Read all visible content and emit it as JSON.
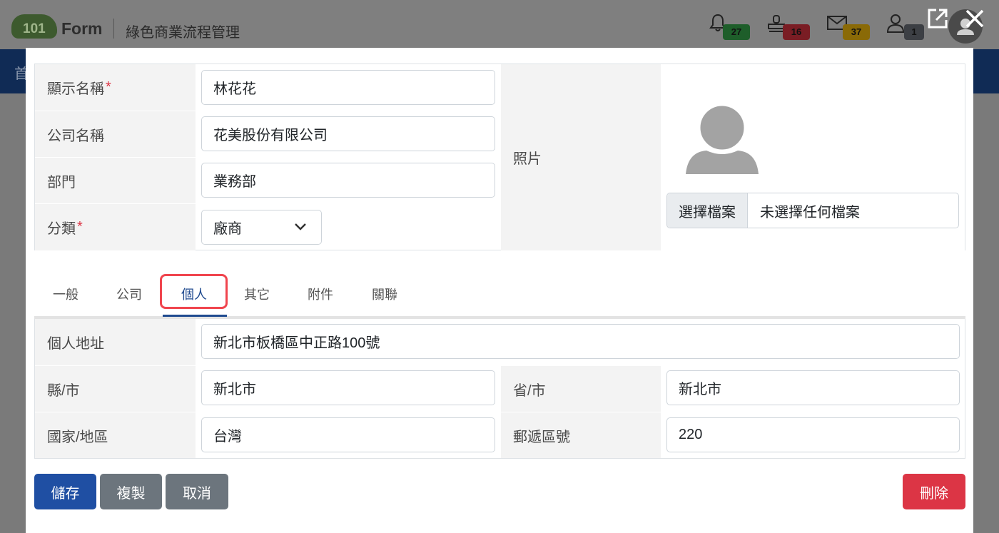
{
  "app": {
    "logo_number": "101",
    "logo_word": "Form",
    "title": "綠色商業流程管理",
    "nav_first": "首"
  },
  "header_badges": [
    {
      "icon": "bell-icon",
      "count": "27",
      "color": "#1e5e2a"
    },
    {
      "icon": "stamp-icon",
      "count": "16",
      "color": "#7a1d24"
    },
    {
      "icon": "mail-icon",
      "count": "37",
      "color": "#8a6a07"
    },
    {
      "icon": "user-icon",
      "count": "1",
      "color": "#3c3f44"
    }
  ],
  "form": {
    "display_name": {
      "label": "顯示名稱",
      "value": "林花花"
    },
    "company_name": {
      "label": "公司名稱",
      "value": "花美股份有限公司"
    },
    "department": {
      "label": "部門",
      "value": "業務部"
    },
    "category": {
      "label": "分類",
      "value": "廠商"
    },
    "photo": {
      "label": "照片",
      "choose_button": "選擇檔案",
      "file_status": "未選擇任何檔案"
    }
  },
  "tabs": [
    "一般",
    "公司",
    "個人",
    "其它",
    "附件",
    "關聯"
  ],
  "active_tab": "個人",
  "personal": {
    "address": {
      "label": "個人地址",
      "value": "新北市板橋區中正路100號"
    },
    "county": {
      "label": "縣/市",
      "value": "新北市"
    },
    "province": {
      "label": "省/市",
      "value": "新北市"
    },
    "country": {
      "label": "國家/地區",
      "value": "台灣"
    },
    "postal": {
      "label": "郵遞區號",
      "value": "220"
    }
  },
  "buttons": {
    "save": "儲存",
    "copy": "複製",
    "cancel": "取消",
    "delete": "刪除"
  },
  "colors": {
    "primary": "#1f4fa3",
    "secondary": "#6c757d",
    "danger": "#dc3545",
    "highlight": "#f0454e"
  }
}
